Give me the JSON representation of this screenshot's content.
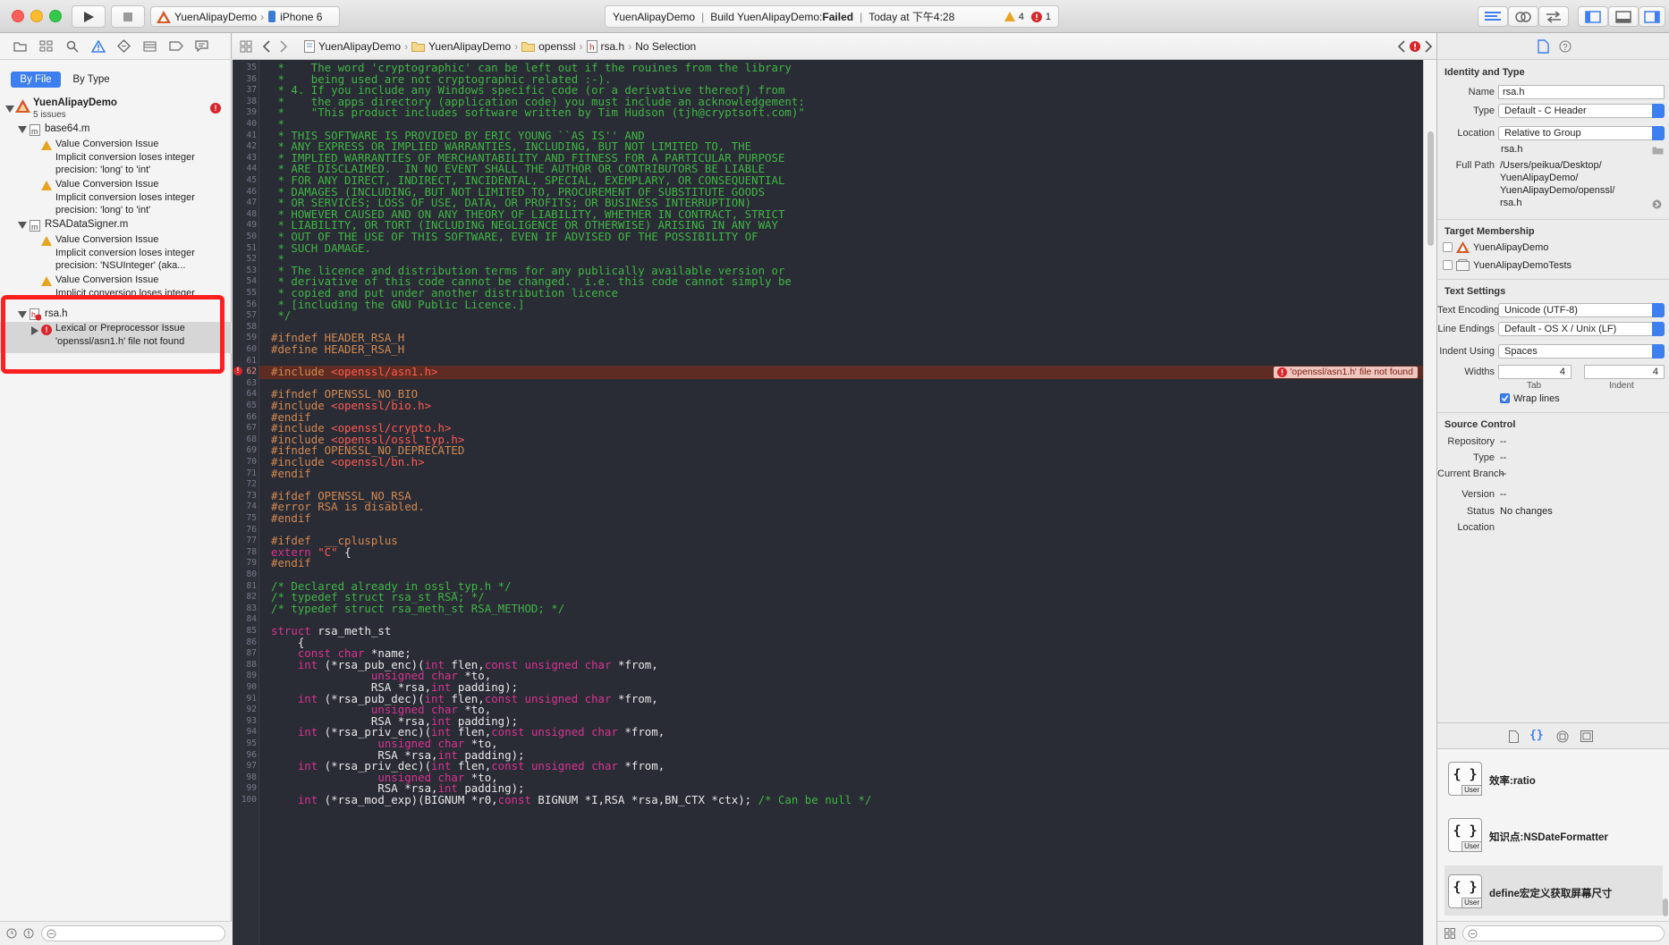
{
  "toolbar": {
    "scheme": "YuenAlipayDemo",
    "device": "iPhone 6",
    "activity_project": "YuenAlipayDemo",
    "build_prefix": "Build YuenAlipayDemo: ",
    "build_status": "Failed",
    "build_time": "Today at 下午4:28",
    "warning_count": "4",
    "error_count": "1"
  },
  "navigator": {
    "tab_byfile": "By File",
    "tab_bytype": "By Type",
    "project": "YuenAlipayDemo",
    "project_issues": "5 issues",
    "files": [
      {
        "name": "base64.m",
        "issues": [
          {
            "title": "Value Conversion Issue",
            "l1": "Implicit conversion loses integer",
            "l2": "precision: 'long' to 'int'"
          },
          {
            "title": "Value Conversion Issue",
            "l1": "Implicit conversion loses integer",
            "l2": "precision: 'long' to 'int'"
          }
        ]
      },
      {
        "name": "RSADataSigner.m",
        "issues": [
          {
            "title": "Value Conversion Issue",
            "l1": "Implicit conversion loses integer",
            "l2": "precision: 'NSUInteger' (aka..."
          },
          {
            "title": "Value Conversion Issue",
            "l1": "Implicit conversion loses integer",
            "l2": ""
          }
        ]
      },
      {
        "name": "rsa.h",
        "issues": [
          {
            "title": "Lexical or Preprocessor Issue",
            "l1": "'openssl/asn1.h' file not found",
            "l2": ""
          }
        ]
      }
    ]
  },
  "jumpbar": {
    "crumbs": [
      "YuenAlipayDemo",
      "YuenAlipayDemo",
      "openssl",
      "rsa.h",
      "No Selection"
    ]
  },
  "editor": {
    "error_message": "'openssl/asn1.h' file not found",
    "lines": [
      {
        "n": "35",
        "segs": [
          [
            "com",
            " *    The word 'cryptographic' can be left out if the rouines from the library"
          ]
        ]
      },
      {
        "n": "36",
        "segs": [
          [
            "com",
            " *    being used are not cryptographic related :-)."
          ]
        ]
      },
      {
        "n": "37",
        "segs": [
          [
            "com",
            " * 4. If you include any Windows specific code (or a derivative thereof) from"
          ]
        ]
      },
      {
        "n": "38",
        "segs": [
          [
            "com",
            " *    the apps directory (application code) you must include an acknowledgement:"
          ]
        ]
      },
      {
        "n": "39",
        "segs": [
          [
            "com",
            " *    \"This product includes software written by Tim Hudson (tjh@cryptsoft.com)\""
          ]
        ]
      },
      {
        "n": "40",
        "segs": [
          [
            "com",
            " *"
          ]
        ]
      },
      {
        "n": "41",
        "segs": [
          [
            "com",
            " * THIS SOFTWARE IS PROVIDED BY ERIC YOUNG ``AS IS'' AND"
          ]
        ]
      },
      {
        "n": "42",
        "segs": [
          [
            "com",
            " * ANY EXPRESS OR IMPLIED WARRANTIES, INCLUDING, BUT NOT LIMITED TO, THE"
          ]
        ]
      },
      {
        "n": "43",
        "segs": [
          [
            "com",
            " * IMPLIED WARRANTIES OF MERCHANTABILITY AND FITNESS FOR A PARTICULAR PURPOSE"
          ]
        ]
      },
      {
        "n": "44",
        "segs": [
          [
            "com",
            " * ARE DISCLAIMED.  IN NO EVENT SHALL THE AUTHOR OR CONTRIBUTORS BE LIABLE"
          ]
        ]
      },
      {
        "n": "45",
        "segs": [
          [
            "com",
            " * FOR ANY DIRECT, INDIRECT, INCIDENTAL, SPECIAL, EXEMPLARY, OR CONSEQUENTIAL"
          ]
        ]
      },
      {
        "n": "46",
        "segs": [
          [
            "com",
            " * DAMAGES (INCLUDING, BUT NOT LIMITED TO, PROCUREMENT OF SUBSTITUTE GOODS"
          ]
        ]
      },
      {
        "n": "47",
        "segs": [
          [
            "com",
            " * OR SERVICES; LOSS OF USE, DATA, OR PROFITS; OR BUSINESS INTERRUPTION)"
          ]
        ]
      },
      {
        "n": "48",
        "segs": [
          [
            "com",
            " * HOWEVER CAUSED AND ON ANY THEORY OF LIABILITY, WHETHER IN CONTRACT, STRICT"
          ]
        ]
      },
      {
        "n": "49",
        "segs": [
          [
            "com",
            " * LIABILITY, OR TORT (INCLUDING NEGLIGENCE OR OTHERWISE) ARISING IN ANY WAY"
          ]
        ]
      },
      {
        "n": "50",
        "segs": [
          [
            "com",
            " * OUT OF THE USE OF THIS SOFTWARE, EVEN IF ADVISED OF THE POSSIBILITY OF"
          ]
        ]
      },
      {
        "n": "51",
        "segs": [
          [
            "com",
            " * SUCH DAMAGE."
          ]
        ]
      },
      {
        "n": "52",
        "segs": [
          [
            "com",
            " *"
          ]
        ]
      },
      {
        "n": "53",
        "segs": [
          [
            "com",
            " * The licence and distribution terms for any publically available version or"
          ]
        ]
      },
      {
        "n": "54",
        "segs": [
          [
            "com",
            " * derivative of this code cannot be changed.  i.e. this code cannot simply be"
          ]
        ]
      },
      {
        "n": "55",
        "segs": [
          [
            "com",
            " * copied and put under another distribution licence"
          ]
        ]
      },
      {
        "n": "56",
        "segs": [
          [
            "com",
            " * [including the GNU Public Licence.]"
          ]
        ]
      },
      {
        "n": "57",
        "segs": [
          [
            "com",
            " */"
          ]
        ]
      },
      {
        "n": "58",
        "segs": []
      },
      {
        "n": "59",
        "segs": [
          [
            "pre",
            "#ifndef HEADER_RSA_H"
          ]
        ]
      },
      {
        "n": "60",
        "segs": [
          [
            "pre",
            "#define HEADER_RSA_H"
          ]
        ]
      },
      {
        "n": "61",
        "segs": []
      },
      {
        "n": "62",
        "segs": [
          [
            "pre",
            "#include "
          ],
          [
            "str",
            "<openssl/asn1.h>"
          ]
        ]
      },
      {
        "n": "63",
        "segs": []
      },
      {
        "n": "64",
        "segs": [
          [
            "pre",
            "#ifndef OPENSSL_NO_BIO"
          ]
        ]
      },
      {
        "n": "65",
        "segs": [
          [
            "pre",
            "#include "
          ],
          [
            "str",
            "<openssl/bio.h>"
          ]
        ]
      },
      {
        "n": "66",
        "segs": [
          [
            "pre",
            "#endif"
          ]
        ]
      },
      {
        "n": "67",
        "segs": [
          [
            "pre",
            "#include "
          ],
          [
            "str",
            "<openssl/crypto.h>"
          ]
        ]
      },
      {
        "n": "68",
        "segs": [
          [
            "pre",
            "#include "
          ],
          [
            "str",
            "<openssl/ossl_typ.h>"
          ]
        ]
      },
      {
        "n": "69",
        "segs": [
          [
            "pre",
            "#ifndef OPENSSL_NO_DEPRECATED"
          ]
        ]
      },
      {
        "n": "70",
        "segs": [
          [
            "pre",
            "#include "
          ],
          [
            "str",
            "<openssl/bn.h>"
          ]
        ]
      },
      {
        "n": "71",
        "segs": [
          [
            "pre",
            "#endif"
          ]
        ]
      },
      {
        "n": "72",
        "segs": []
      },
      {
        "n": "73",
        "segs": [
          [
            "pre",
            "#ifdef OPENSSL_NO_RSA"
          ]
        ]
      },
      {
        "n": "74",
        "segs": [
          [
            "pre",
            "#error RSA is disabled."
          ]
        ]
      },
      {
        "n": "75",
        "segs": [
          [
            "pre",
            "#endif"
          ]
        ]
      },
      {
        "n": "76",
        "segs": []
      },
      {
        "n": "77",
        "segs": [
          [
            "pre",
            "#ifdef  __cplusplus"
          ]
        ]
      },
      {
        "n": "78",
        "segs": [
          [
            "kw",
            "extern "
          ],
          [
            "str",
            "\"C\""
          ],
          [
            "id",
            " {"
          ]
        ]
      },
      {
        "n": "79",
        "segs": [
          [
            "pre",
            "#endif"
          ]
        ]
      },
      {
        "n": "80",
        "segs": []
      },
      {
        "n": "81",
        "segs": [
          [
            "com",
            "/* Declared already in ossl_typ.h */"
          ]
        ]
      },
      {
        "n": "82",
        "segs": [
          [
            "com",
            "/* typedef struct rsa_st RSA; */"
          ]
        ]
      },
      {
        "n": "83",
        "segs": [
          [
            "com",
            "/* typedef struct rsa_meth_st RSA_METHOD; */"
          ]
        ]
      },
      {
        "n": "84",
        "segs": []
      },
      {
        "n": "85",
        "segs": [
          [
            "kw",
            "struct"
          ],
          [
            "id",
            " rsa_meth_st"
          ]
        ]
      },
      {
        "n": "86",
        "segs": [
          [
            "id",
            "    {"
          ]
        ]
      },
      {
        "n": "87",
        "segs": [
          [
            "kw",
            "    const char"
          ],
          [
            "id",
            " *name;"
          ]
        ]
      },
      {
        "n": "88",
        "segs": [
          [
            "kw",
            "    int"
          ],
          [
            "id",
            " (*rsa_pub_enc)("
          ],
          [
            "kw",
            "int"
          ],
          [
            "id",
            " flen,"
          ],
          [
            "kw",
            "const unsigned char"
          ],
          [
            "id",
            " *from,"
          ]
        ]
      },
      {
        "n": "89",
        "segs": [
          [
            "kw",
            "               unsigned char"
          ],
          [
            "id",
            " *to,"
          ]
        ]
      },
      {
        "n": "90",
        "segs": [
          [
            "id",
            "               RSA *rsa,"
          ],
          [
            "kw",
            "int"
          ],
          [
            "id",
            " padding);"
          ]
        ]
      },
      {
        "n": "91",
        "segs": [
          [
            "kw",
            "    int"
          ],
          [
            "id",
            " (*rsa_pub_dec)("
          ],
          [
            "kw",
            "int"
          ],
          [
            "id",
            " flen,"
          ],
          [
            "kw",
            "const unsigned char"
          ],
          [
            "id",
            " *from,"
          ]
        ]
      },
      {
        "n": "92",
        "segs": [
          [
            "kw",
            "               unsigned char"
          ],
          [
            "id",
            " *to,"
          ]
        ]
      },
      {
        "n": "93",
        "segs": [
          [
            "id",
            "               RSA *rsa,"
          ],
          [
            "kw",
            "int"
          ],
          [
            "id",
            " padding);"
          ]
        ]
      },
      {
        "n": "94",
        "segs": [
          [
            "kw",
            "    int"
          ],
          [
            "id",
            " (*rsa_priv_enc)("
          ],
          [
            "kw",
            "int"
          ],
          [
            "id",
            " flen,"
          ],
          [
            "kw",
            "const unsigned char"
          ],
          [
            "id",
            " *from,"
          ]
        ]
      },
      {
        "n": "95",
        "segs": [
          [
            "kw",
            "                unsigned char"
          ],
          [
            "id",
            " *to,"
          ]
        ]
      },
      {
        "n": "96",
        "segs": [
          [
            "id",
            "                RSA *rsa,"
          ],
          [
            "kw",
            "int"
          ],
          [
            "id",
            " padding);"
          ]
        ]
      },
      {
        "n": "97",
        "segs": [
          [
            "kw",
            "    int"
          ],
          [
            "id",
            " (*rsa_priv_dec)("
          ],
          [
            "kw",
            "int"
          ],
          [
            "id",
            " flen,"
          ],
          [
            "kw",
            "const unsigned char"
          ],
          [
            "id",
            " *from,"
          ]
        ]
      },
      {
        "n": "98",
        "segs": [
          [
            "kw",
            "                unsigned char"
          ],
          [
            "id",
            " *to,"
          ]
        ]
      },
      {
        "n": "99",
        "segs": [
          [
            "id",
            "                RSA *rsa,"
          ],
          [
            "kw",
            "int"
          ],
          [
            "id",
            " padding);"
          ]
        ]
      },
      {
        "n": "100",
        "segs": [
          [
            "kw",
            "    int"
          ],
          [
            "id",
            " (*rsa_mod_exp)(BIGNUM *r0,"
          ],
          [
            "kw",
            "const"
          ],
          [
            "id",
            " BIGNUM *I,RSA *rsa,BN_CTX *ctx); "
          ],
          [
            "com",
            "/* Can be null */"
          ]
        ]
      }
    ]
  },
  "inspector": {
    "identity_header": "Identity and Type",
    "name_label": "Name",
    "name_value": "rsa.h",
    "type_label": "Type",
    "type_value": "Default - C Header",
    "location_label": "Location",
    "location_value": "Relative to Group",
    "location_file": "rsa.h",
    "fullpath_label": "Full Path",
    "fullpath_lines": [
      "/Users/peikua/Desktop/",
      "YuenAlipayDemo/",
      "YuenAlipayDemo/openssl/",
      "rsa.h"
    ],
    "target_header": "Target Membership",
    "targets": [
      "YuenAlipayDemo",
      "YuenAlipayDemoTests"
    ],
    "text_header": "Text Settings",
    "encoding_label": "Text Encoding",
    "encoding_value": "Unicode (UTF-8)",
    "lineend_label": "Line Endings",
    "lineend_value": "Default - OS X / Unix (LF)",
    "indent_label": "Indent Using",
    "indent_value": "Spaces",
    "widths_label": "Widths",
    "tab_width": "4",
    "indent_width": "4",
    "tab_caption": "Tab",
    "indent_caption": "Indent",
    "wrap_label": "Wrap lines",
    "sc_header": "Source Control",
    "repo_label": "Repository",
    "repo_value": "--",
    "sctype_label": "Type",
    "sctype_value": "--",
    "branch_label": "Current Branch",
    "branch_value": "--",
    "version_label": "Version",
    "version_value": "--",
    "status_label": "Status",
    "status_value": "No changes",
    "loc_label": "Location",
    "snippets": [
      {
        "icon": "{ }",
        "badge": "User",
        "title": "效率:ratio"
      },
      {
        "icon": "{ }",
        "badge": "User",
        "title": "知识点:NSDateFormatter"
      },
      {
        "icon": "{ }",
        "badge": "User",
        "title": "define宏定义获取屏幕尺寸"
      }
    ]
  },
  "colors": {
    "accent": "#3d7ef0",
    "error": "#d8262b",
    "warning": "#e7a321",
    "highlight": "#ff1f1f"
  }
}
